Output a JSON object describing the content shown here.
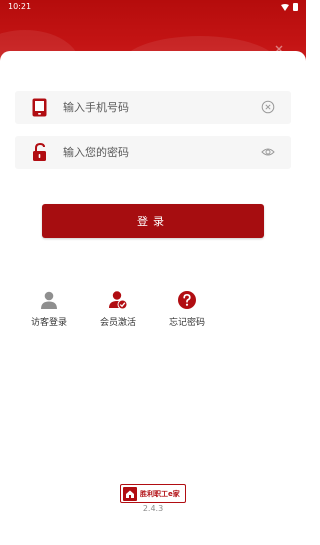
{
  "status_bar": {
    "time": "10:21"
  },
  "login_form": {
    "phone_placeholder": "输入手机号码",
    "password_placeholder": "输入您的密码"
  },
  "login_button_label": "登录",
  "shortcuts": [
    {
      "label": "访客登录",
      "icon": "person-icon"
    },
    {
      "label": "会员激活",
      "icon": "member-check-icon"
    },
    {
      "label": "忘记密码",
      "icon": "question-icon"
    }
  ],
  "footer": {
    "logo_text": "胜利职工e家",
    "version": "2.4.3"
  },
  "colors": {
    "brand_red": "#a60d10",
    "icon_red": "#b10d12",
    "header_red": "#c41414",
    "field_bg": "#f6f6f6",
    "icon_gray": "#9b9b9b"
  }
}
